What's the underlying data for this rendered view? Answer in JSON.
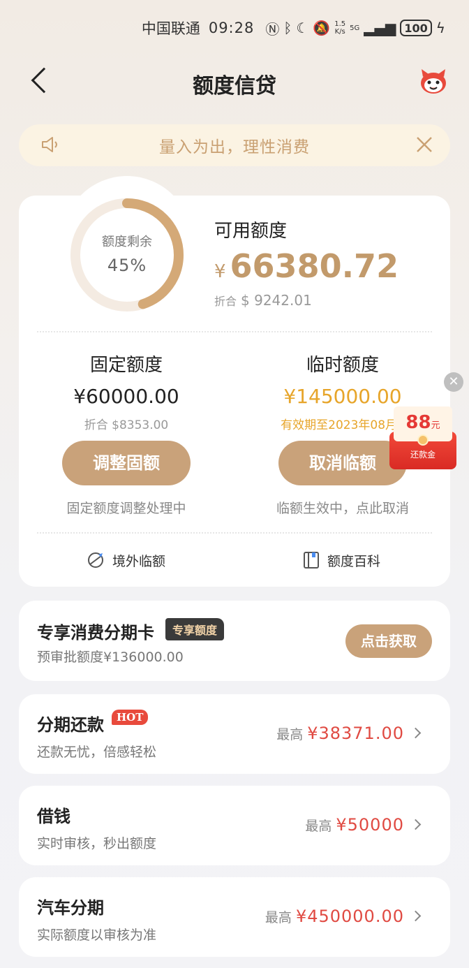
{
  "status_bar": {
    "carrier": "中国联通",
    "time": "09:28",
    "net_speed_value": "1.5",
    "net_speed_unit": "K/s",
    "network": "5G",
    "battery": "100"
  },
  "nav": {
    "title": "额度信贷"
  },
  "notice": {
    "text": "量入为出，理性消费"
  },
  "quota": {
    "ring_label": "额度剩余",
    "ring_percent": "45%",
    "ring_fraction": 0.45,
    "available_title": "可用额度",
    "currency_symbol": "¥",
    "available_amount": "66380.72",
    "conv_label": "折合",
    "conv_value": "$ 9242.01",
    "fixed": {
      "title": "固定额度",
      "amount": "¥60000.00",
      "conv": "折合 $8353.00",
      "button": "调整固额",
      "note": "固定额度调整处理中"
    },
    "temp": {
      "title": "临时额度",
      "amount": "¥145000.00",
      "validity": "有效期至2023年08月1",
      "button": "取消临额",
      "note": "临额生效中，点此取消"
    },
    "links": {
      "overseas": "境外临额",
      "wiki": "额度百科"
    }
  },
  "red_packet": {
    "amount": "88",
    "unit": "元",
    "label": "还款金"
  },
  "exclusive": {
    "title": "专享消费分期卡",
    "tag": "专享额度",
    "sub": "预审批额度¥136000.00",
    "button": "点击获取"
  },
  "products": [
    {
      "title": "分期还款",
      "badge": "HOT",
      "sub": "还款无忧，倍感轻松",
      "prefix": "最高",
      "value": "¥38371.00"
    },
    {
      "title": "借钱",
      "sub": "实时审核，秒出额度",
      "prefix": "最高",
      "value": "¥50000"
    },
    {
      "title": "汽车分期",
      "sub": "实际额度以审核为准",
      "prefix": "最高",
      "value": "¥450000.00"
    }
  ],
  "colors": {
    "gold": "#c9a27a",
    "accent_red": "#e04a42",
    "temp_gold": "#e7a52a"
  }
}
